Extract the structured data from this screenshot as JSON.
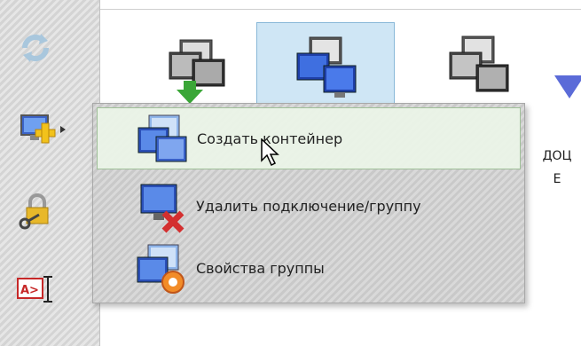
{
  "toolbar": {
    "items": [
      {
        "name": "refresh-icon"
      },
      {
        "name": "add-computer-icon"
      },
      {
        "name": "lock-key-icon"
      },
      {
        "name": "rename-icon"
      }
    ]
  },
  "content": {
    "tiles": [
      {
        "name": "computers-download-icon",
        "selected": false
      },
      {
        "name": "computers-group-icon",
        "selected": true
      },
      {
        "name": "computers-gray-icon",
        "selected": false
      }
    ],
    "side_text_line1": "ДОЦ",
    "side_text_line2": "Е"
  },
  "context_menu": {
    "items": [
      {
        "label": "Создать контейнер",
        "icon": "create-container-icon",
        "hovered": true
      },
      {
        "label": "Удалить подключение/группу",
        "icon": "delete-connection-icon",
        "hovered": false
      },
      {
        "label": "Свойства группы",
        "icon": "group-properties-icon",
        "hovered": false
      }
    ]
  },
  "colors": {
    "selected_tile_bg": "#cfe6f5",
    "menu_hover_bg": "#ebf5e8"
  }
}
